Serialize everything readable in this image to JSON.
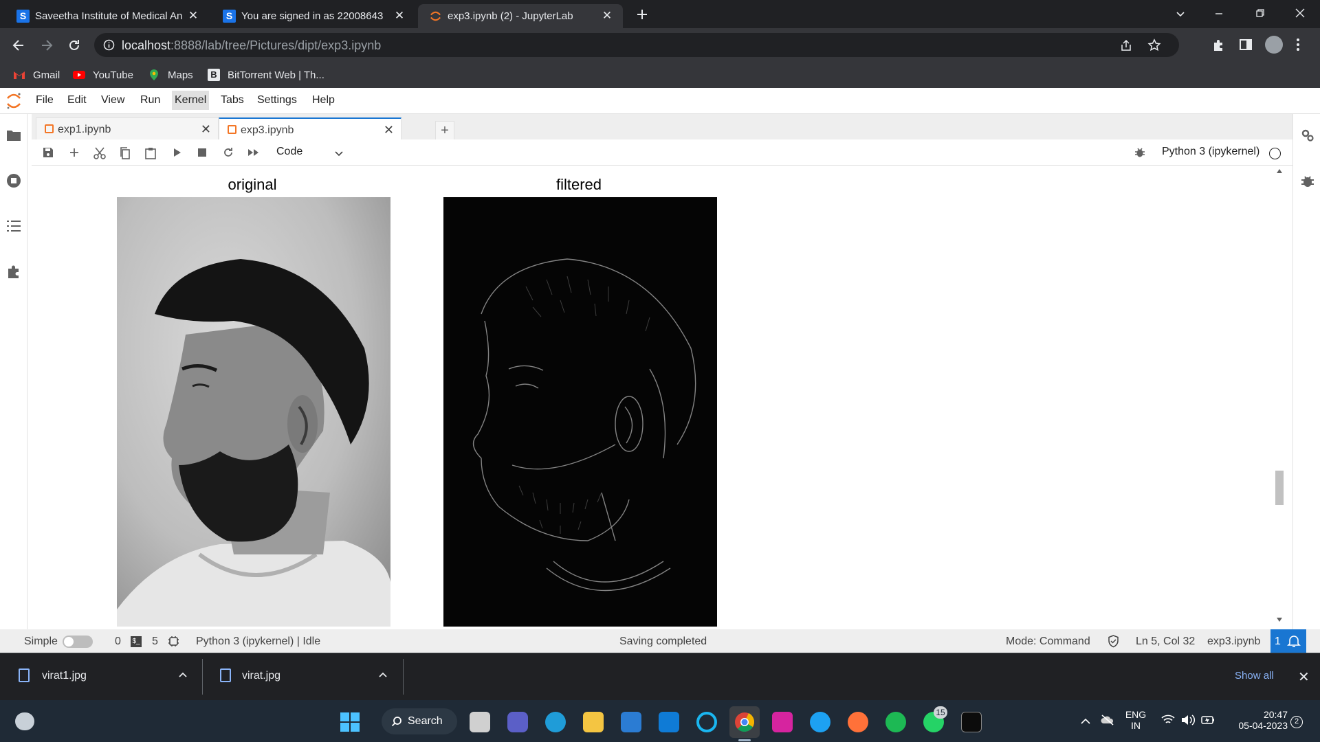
{
  "browser": {
    "tabs": [
      {
        "title": "Saveetha Institute of Medical An",
        "favicon": "S",
        "active": false
      },
      {
        "title": "You are signed in as 22008643",
        "favicon": "S",
        "active": false
      },
      {
        "title": "exp3.ipynb (2) - JupyterLab",
        "favicon": "jupyter",
        "active": true
      }
    ],
    "url_host": "localhost",
    "url_path": ":8888/lab/tree/Pictures/dipt/exp3.ipynb",
    "bookmarks": [
      {
        "label": "Gmail",
        "icon": "gmail-icon"
      },
      {
        "label": "YouTube",
        "icon": "youtube-icon"
      },
      {
        "label": "Maps",
        "icon": "maps-icon"
      },
      {
        "label": "BitTorrent Web | Th...",
        "icon": "bittorrent-icon"
      }
    ]
  },
  "jupyter": {
    "menus": [
      "File",
      "Edit",
      "View",
      "Run",
      "Kernel",
      "Tabs",
      "Settings",
      "Help"
    ],
    "highlighted_menu": "Kernel",
    "tabs": [
      {
        "label": "exp1.ipynb",
        "active": false
      },
      {
        "label": "exp3.ipynb",
        "active": true
      }
    ],
    "cell_type": "Code",
    "kernel": "Python 3 (ipykernel)",
    "output": {
      "images": [
        {
          "title": "original",
          "style": "grayscale portrait"
        },
        {
          "title": "filtered",
          "style": "edge-filtered portrait"
        }
      ]
    },
    "status": {
      "mode_label": "Simple",
      "terminals": "0",
      "kernels": "5",
      "kernel_status": "Python 3 (ipykernel) | Idle",
      "message": "Saving completed",
      "mode": "Mode: Command",
      "cursor": "Ln 5, Col 32",
      "file": "exp3.ipynb",
      "notifications": "1"
    }
  },
  "downloads": {
    "items": [
      "virat1.jpg",
      "virat.jpg"
    ],
    "show_all": "Show all"
  },
  "taskbar": {
    "search_label": "Search",
    "whatsapp_badge": "15",
    "lang1": "ENG",
    "lang2": "IN",
    "time": "20:47",
    "date": "05-04-2023",
    "notif_count": "2"
  },
  "colors": {
    "chrome_dark": "#202124",
    "chrome_toolbar": "#35363a",
    "jupyter_accent": "#f37626",
    "jupyter_blue": "#1976d2"
  }
}
